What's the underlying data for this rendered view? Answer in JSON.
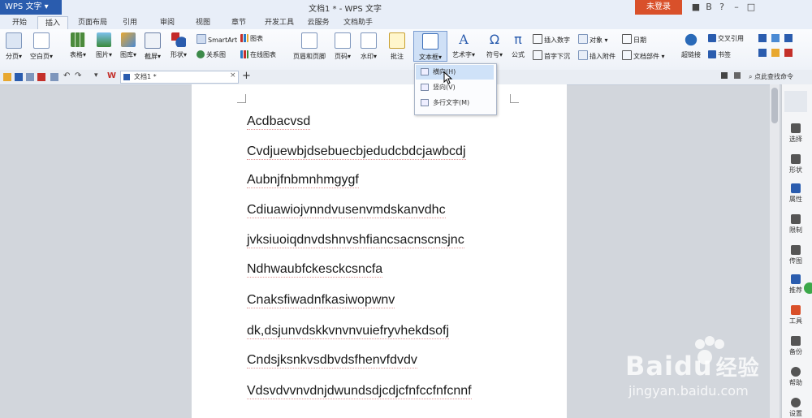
{
  "titlebar": {
    "app_menu": "WPS 文字",
    "doc_title": "文档1 * - WPS 文字",
    "login": "未登录"
  },
  "tabs": [
    "开始",
    "插入",
    "页面布局",
    "引用",
    "审阅",
    "视图",
    "章节",
    "开发工具",
    "云服务",
    "文档助手"
  ],
  "active_tab": "插入",
  "ribbon": {
    "page": "分页",
    "blank_page": "空白页",
    "table": "表格",
    "picture": "图片",
    "gallery": "图库",
    "screenshot": "截屏",
    "shape": "形状",
    "smartart": "SmartArt",
    "chart": "图表",
    "relation": "关系图",
    "online_chart": "在线图表",
    "header_footer": "页眉和页脚",
    "page_number": "页码",
    "watermark": "水印",
    "comment": "批注",
    "textbox": "文本框",
    "wordart": "艺术字",
    "symbol": "符号",
    "formula": "公式",
    "insert_number": "插入数字",
    "object": "对象",
    "date": "日期",
    "first_letter": "首字下沉",
    "attachment": "插入附件",
    "doc_parts": "文档部件",
    "hyperlink": "超链接",
    "cross_ref": "交叉引用",
    "bookmark": "书签"
  },
  "textbox_menu": {
    "items": [
      "横向(H)",
      "竖向(V)",
      "多行文字(M)"
    ]
  },
  "doc_tab": {
    "label": "文档1 *"
  },
  "search_cmd": "点此查找命令",
  "document": {
    "lines": [
      "Acdbacvsd",
      "Cvdjuewbjdsebuecbjedudcbdcjawbcdj",
      "Aubnjfnbmnhmgygf",
      "Cdiuawiojvnndvusenvmdskanvdhc",
      "jvksiuoiqdnvdshnvshfiancsacnscnsjnc",
      "Ndhwaubfckesckcsncfa",
      "Cnaksfiwadnfkasiwopwnv",
      "dk,dsjunvdskkvnvnvuiefryvhekdsofj",
      "Cndsjksnkvsdbvdsfhenvfdvdv",
      "Vdsvdvvnvdnjdwundsdjcdjcfnfccfnfcnnf"
    ]
  },
  "sidebar": {
    "items": [
      "选择",
      "形状",
      "属性",
      "限制",
      "传图",
      "推荐",
      "工具",
      "备份",
      "帮助",
      "设置"
    ]
  },
  "watermark": {
    "brand": "Baidu",
    "brand_cn": "经验",
    "url": "jingyan.baidu.com"
  },
  "colors": {
    "brand_blue": "#2a5cae",
    "login_orange": "#d9502a",
    "underline_red": "#e49a9a"
  }
}
